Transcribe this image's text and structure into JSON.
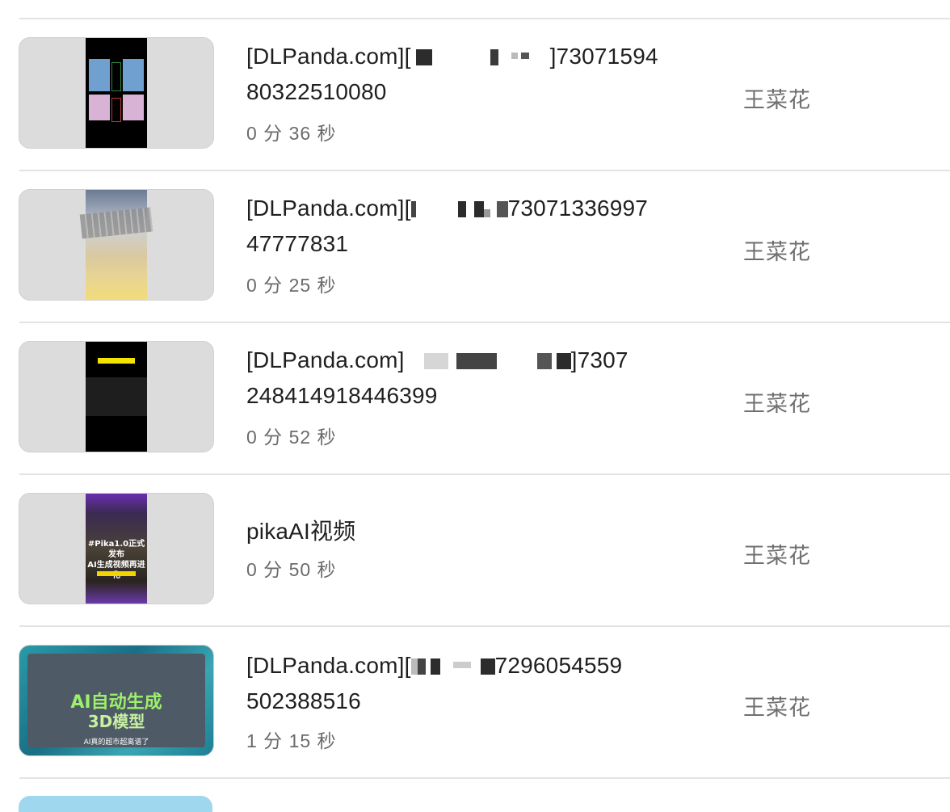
{
  "videos": [
    {
      "title_line1": "[DLPanda.com][",
      "title_mid": "]73071594",
      "title_line2": "80322510080",
      "duration": "0 分 36 秒",
      "author": "王菜花"
    },
    {
      "title_line1": "[DLPanda.com][",
      "title_mid": "73071336997",
      "title_line2": "47777831",
      "duration": "0 分 25 秒",
      "author": "王菜花"
    },
    {
      "title_line1": "[DLPanda.com]",
      "title_mid": "]7307",
      "title_line2": "248414918446399",
      "duration": "0 分 52 秒",
      "author": "王菜花"
    },
    {
      "title_line1": "pikaAI视频",
      "duration": "0 分 50 秒",
      "author": "王菜花"
    },
    {
      "title_line1": "[DLPanda.com][",
      "title_mid": "7296054559",
      "title_line2": "502388516",
      "duration": "1 分 15 秒",
      "author": "王菜花",
      "thumb_text_main": "AI自动生成",
      "thumb_text_sub": "3D模型",
      "thumb_caption": "AI真的超市超离谱了"
    }
  ],
  "thumb4_text": [
    "#Pika1.0正式发布",
    "AI生成视频再进化"
  ]
}
